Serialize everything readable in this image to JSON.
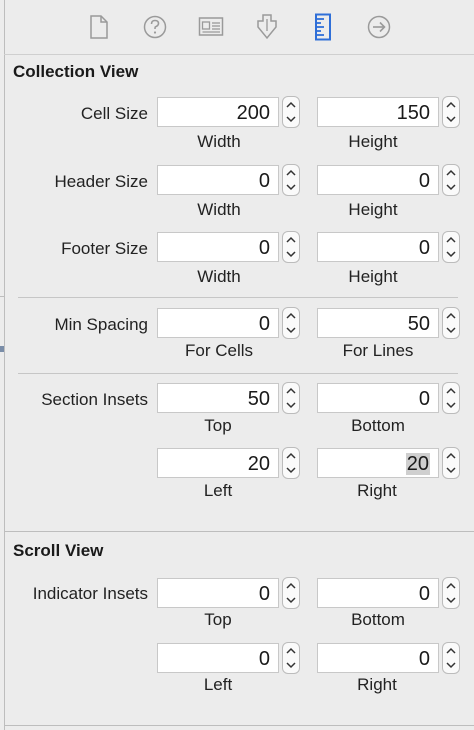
{
  "toolbar": {
    "tabs": [
      {
        "icon": "file-inspector-icon"
      },
      {
        "icon": "quick-help-icon"
      },
      {
        "icon": "identity-inspector-icon"
      },
      {
        "icon": "attributes-inspector-icon"
      },
      {
        "icon": "size-inspector-icon"
      },
      {
        "icon": "connections-inspector-icon"
      }
    ],
    "active_color": "#2f6fd8"
  },
  "collection_view": {
    "title": "Collection View",
    "cell_size": {
      "label": "Cell Size",
      "width": "200",
      "height": "150",
      "width_label": "Width",
      "height_label": "Height"
    },
    "header_size": {
      "label": "Header Size",
      "width": "0",
      "height": "0",
      "width_label": "Width",
      "height_label": "Height"
    },
    "footer_size": {
      "label": "Footer Size",
      "width": "0",
      "height": "0",
      "width_label": "Width",
      "height_label": "Height"
    },
    "min_spacing": {
      "label": "Min Spacing",
      "for_cells": "0",
      "for_lines": "50",
      "cells_label": "For Cells",
      "lines_label": "For Lines"
    },
    "section_insets": {
      "label": "Section Insets",
      "top": "50",
      "bottom": "0",
      "left": "20",
      "right": "20",
      "top_label": "Top",
      "bottom_label": "Bottom",
      "left_label": "Left",
      "right_label": "Right"
    }
  },
  "scroll_view": {
    "title": "Scroll View",
    "indicator_insets": {
      "label": "Indicator Insets",
      "top": "0",
      "bottom": "0",
      "left": "0",
      "right": "0",
      "top_label": "Top",
      "bottom_label": "Bottom",
      "left_label": "Left",
      "right_label": "Right"
    }
  }
}
